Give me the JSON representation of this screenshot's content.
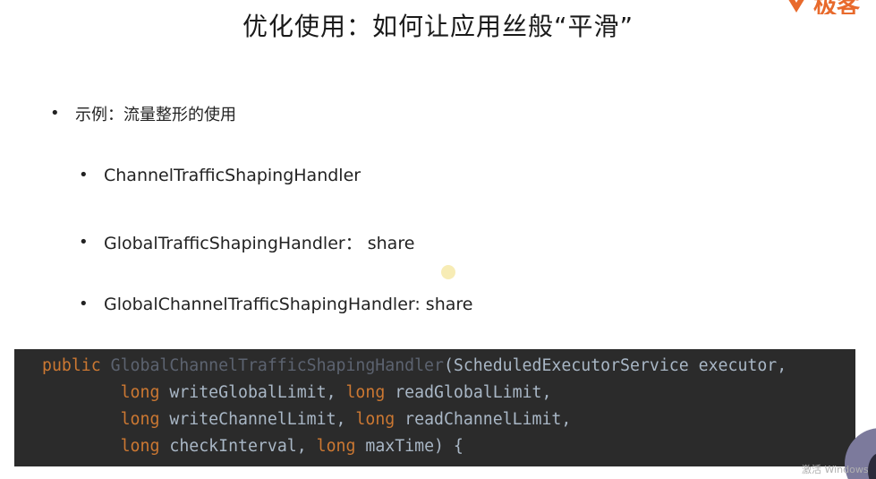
{
  "slide": {
    "title": "优化使用：如何让应用丝般“平滑”",
    "logo_text": "极客",
    "bullets": {
      "main": "示例：流量整形的使用",
      "items": [
        "ChannelTrafficShapingHandler",
        "GlobalTrafficShapingHandler：  share",
        "GlobalChannelTrafficShapingHandler: share"
      ]
    }
  },
  "code": {
    "line1": {
      "kw": "public ",
      "ctor": "GlobalChannelTrafficShapingHandler",
      "rest": "(ScheduledExecutorService executor,"
    },
    "line2": {
      "indent": "        ",
      "kw1": "long",
      "mid": " writeGlobalLimit, ",
      "kw2": "long",
      "rest": " readGlobalLimit,"
    },
    "line3": {
      "indent": "        ",
      "kw1": "long",
      "mid": " writeChannelLimit, ",
      "kw2": "long",
      "rest": " readChannelLimit,"
    },
    "line4": {
      "indent": "        ",
      "kw1": "long",
      "mid": " checkInterval, ",
      "kw2": "long",
      "rest": " maxTime) {"
    }
  },
  "watermark": "激活 Windows",
  "colors": {
    "code_bg": "#2b2b2b",
    "keyword": "#cc7832",
    "identifier": "#a9b7c6",
    "constructor_name": "#5c6370",
    "logo": "#e86a2c"
  },
  "icons": [
    "logo-icon",
    "bullet-icon",
    "presenter-avatar"
  ]
}
